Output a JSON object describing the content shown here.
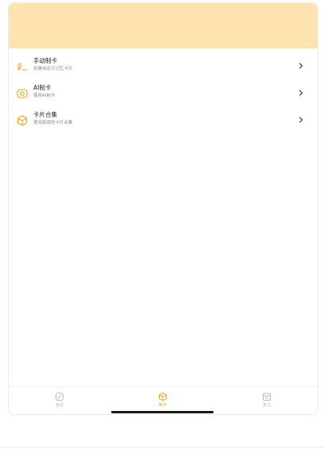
{
  "colors": {
    "banner": "#ffe4b2",
    "accent": "#f2a51a",
    "tab_inactive": "#b8b8b8",
    "chevron": "#333333"
  },
  "menu": [
    {
      "icon": "signature-icon",
      "title": "手动制卡",
      "subtitle": "创建自定义记忆卡片"
    },
    {
      "icon": "ai-eye-icon",
      "title": "AI制卡",
      "subtitle": "使用AI制卡"
    },
    {
      "icon": "cube-icon",
      "title": "卡片合集",
      "subtitle": "使用现成的卡片合集"
    }
  ],
  "tabbar": {
    "tabs": [
      {
        "icon": "home-icon",
        "label": "首页",
        "active": false
      },
      {
        "icon": "box-icon",
        "label": "制卡",
        "active": true
      },
      {
        "icon": "calendar-icon",
        "label": "复习",
        "active": false
      }
    ]
  }
}
